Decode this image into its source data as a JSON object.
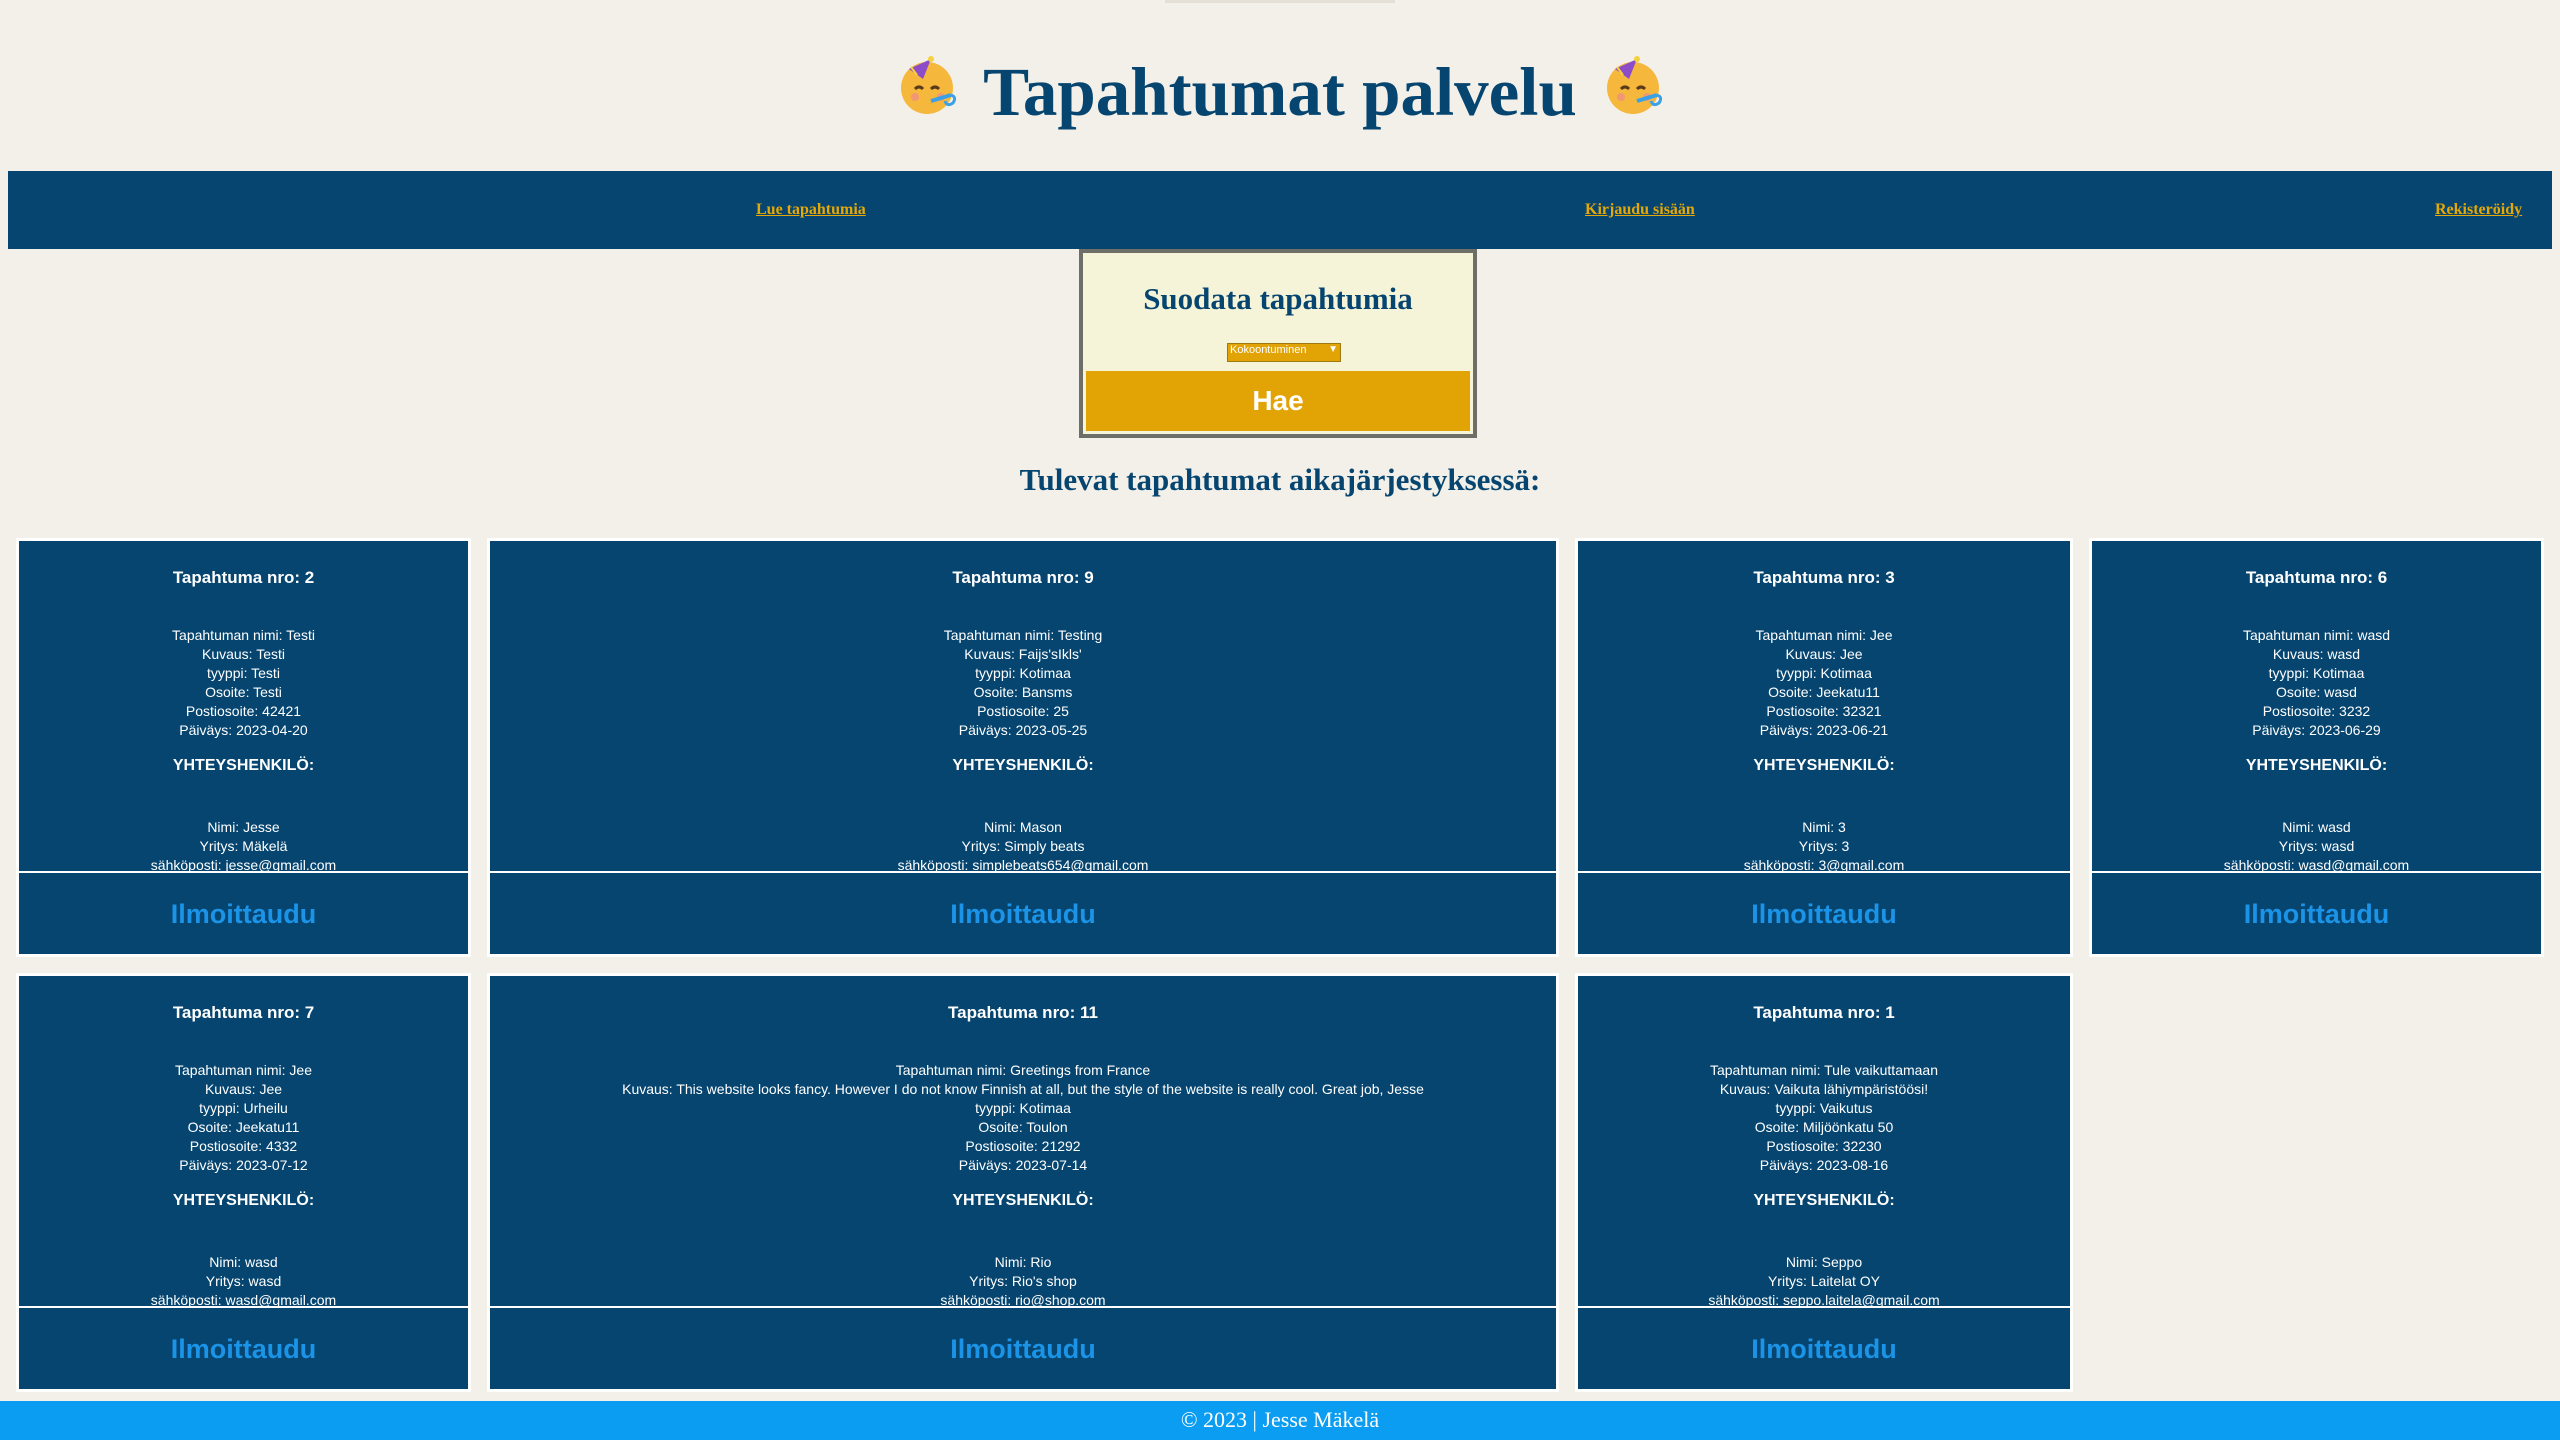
{
  "header": {
    "title": "Tapahtumat palvelu"
  },
  "nav": {
    "links": [
      "Lue tapahtumia",
      "Kirjaudu sisään",
      "Rekisteröidy"
    ]
  },
  "filter": {
    "title": "Suodata tapahtumia",
    "selected": "Kokoontuminen",
    "button_label": "Hae"
  },
  "events_heading": "Tulevat tapahtumat aikajärjestyksessä:",
  "contact_heading": "YHTEYSHENKILÖ:",
  "register_label": "Ilmoittaudu",
  "events": [
    {
      "title": "Tapahtuma nro: 2",
      "name": "Tapahtuman nimi: Testi",
      "desc": "Kuvaus: Testi",
      "type": "tyyppi: Testi",
      "address": "Osoite: Testi",
      "postal": "Postiosoite: 42421",
      "date": "Päiväys: 2023-04-20",
      "contact_name": "Nimi: Jesse",
      "company": "Yritys: Mäkelä",
      "email": "sähköposti: jesse@gmail.com"
    },
    {
      "title": "Tapahtuma nro: 9",
      "name": "Tapahtuman nimi: Testing",
      "desc": "Kuvaus: Faijs'sIkls'",
      "type": "tyyppi: Kotimaa",
      "address": "Osoite: Bansms",
      "postal": "Postiosoite: 25",
      "date": "Päiväys: 2023-05-25",
      "contact_name": "Nimi: Mason",
      "company": "Yritys: Simply beats",
      "email": "sähköposti: simplebeats654@gmail.com"
    },
    {
      "title": "Tapahtuma nro: 3",
      "name": "Tapahtuman nimi: Jee",
      "desc": "Kuvaus: Jee",
      "type": "tyyppi: Kotimaa",
      "address": "Osoite: Jeekatu11",
      "postal": "Postiosoite: 32321",
      "date": "Päiväys: 2023-06-21",
      "contact_name": "Nimi: 3",
      "company": "Yritys: 3",
      "email": "sähköposti: 3@gmail.com"
    },
    {
      "title": "Tapahtuma nro: 6",
      "name": "Tapahtuman nimi: wasd",
      "desc": "Kuvaus: wasd",
      "type": "tyyppi: Kotimaa",
      "address": "Osoite: wasd",
      "postal": "Postiosoite: 3232",
      "date": "Päiväys: 2023-06-29",
      "contact_name": "Nimi: wasd",
      "company": "Yritys: wasd",
      "email": "sähköposti: wasd@gmail.com"
    },
    {
      "title": "Tapahtuma nro: 7",
      "name": "Tapahtuman nimi: Jee",
      "desc": "Kuvaus: Jee",
      "type": "tyyppi: Urheilu",
      "address": "Osoite: Jeekatu11",
      "postal": "Postiosoite: 4332",
      "date": "Päiväys: 2023-07-12",
      "contact_name": "Nimi: wasd",
      "company": "Yritys: wasd",
      "email": "sähköposti: wasd@gmail.com"
    },
    {
      "title": "Tapahtuma nro: 11",
      "name": "Tapahtuman nimi: Greetings from France",
      "desc": "Kuvaus: This website looks fancy. However I do not know Finnish at all, but the style of the website is really cool. Great job, Jesse",
      "type": "tyyppi: Kotimaa",
      "address": "Osoite: Toulon",
      "postal": "Postiosoite: 21292",
      "date": "Päiväys: 2023-07-14",
      "contact_name": "Nimi: Rio",
      "company": "Yritys: Rio's shop",
      "email": "sähköposti: rio@shop.com"
    },
    {
      "title": "Tapahtuma nro: 1",
      "name": "Tapahtuman nimi: Tule vaikuttamaan",
      "desc": "Kuvaus: Vaikuta lähiympäristöösi!",
      "type": "tyyppi: Vaikutus",
      "address": "Osoite: Miljöönkatu 50",
      "postal": "Postiosoite: 32230",
      "date": "Päiväys: 2023-08-16",
      "contact_name": "Nimi: Seppo",
      "company": "Yritys: Laitelat OY",
      "email": "sähköposti: seppo.laitela@gmail.com"
    }
  ],
  "footer": {
    "text": "© 2023 | Jesse Mäkelä"
  },
  "colors": {
    "navy": "#054570",
    "gold": "#e2a304",
    "footer_blue": "#0a9df2",
    "button_text": "#1b94e8",
    "background": "#f3f0e9"
  }
}
